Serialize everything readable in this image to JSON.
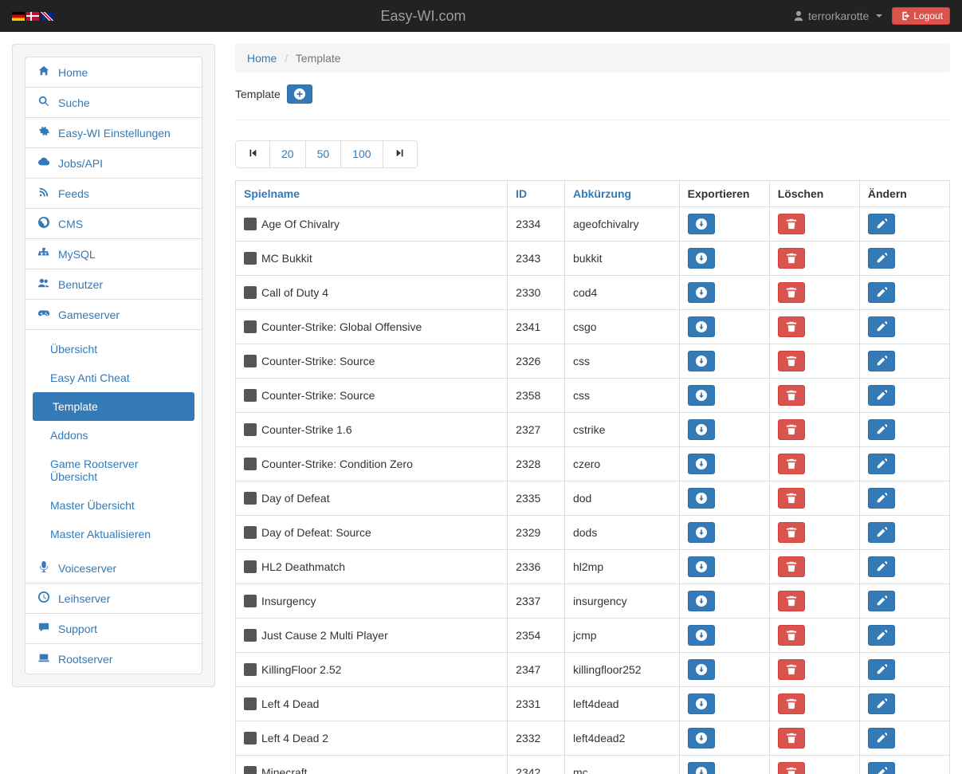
{
  "navbar": {
    "brand": "Easy-WI.com",
    "username": "terrorkarotte",
    "logout": "Logout"
  },
  "sidebar": {
    "items": [
      {
        "label": "Home",
        "icon": "home"
      },
      {
        "label": "Suche",
        "icon": "search"
      },
      {
        "label": "Easy-WI Einstellungen",
        "icon": "cogs"
      },
      {
        "label": "Jobs/API",
        "icon": "cloud"
      },
      {
        "label": "Feeds",
        "icon": "rss"
      },
      {
        "label": "CMS",
        "icon": "globe"
      },
      {
        "label": "MySQL",
        "icon": "sitemap"
      },
      {
        "label": "Benutzer",
        "icon": "users"
      },
      {
        "label": "Gameserver",
        "icon": "gamepad"
      },
      {
        "label": "Voiceserver",
        "icon": "microphone"
      },
      {
        "label": "Leihserver",
        "icon": "clock"
      },
      {
        "label": "Support",
        "icon": "comment"
      },
      {
        "label": "Rootserver",
        "icon": "laptop"
      }
    ],
    "sub": [
      {
        "label": "Übersicht",
        "active": false
      },
      {
        "label": "Easy Anti Cheat",
        "active": false
      },
      {
        "label": "Template",
        "active": true
      },
      {
        "label": "Addons",
        "active": false
      },
      {
        "label": "Game Rootserver Übersicht",
        "active": false
      },
      {
        "label": "Master Übersicht",
        "active": false
      },
      {
        "label": "Master Aktualisieren",
        "active": false
      }
    ]
  },
  "breadcrumb": {
    "home": "Home",
    "current": "Template"
  },
  "page": {
    "title": "Template"
  },
  "pagination": {
    "sizes": [
      "20",
      "50",
      "100"
    ]
  },
  "table": {
    "headers": {
      "name": "Spielname",
      "id": "ID",
      "abbr": "Abkürzung",
      "export": "Exportieren",
      "delete": "Löschen",
      "edit": "Ändern"
    },
    "rows": [
      {
        "name": "Age Of Chivalry",
        "id": "2334",
        "abbr": "ageofchivalry"
      },
      {
        "name": "MC Bukkit",
        "id": "2343",
        "abbr": "bukkit"
      },
      {
        "name": "Call of Duty 4",
        "id": "2330",
        "abbr": "cod4"
      },
      {
        "name": "Counter-Strike: Global Offensive",
        "id": "2341",
        "abbr": "csgo"
      },
      {
        "name": "Counter-Strike: Source",
        "id": "2326",
        "abbr": "css"
      },
      {
        "name": "Counter-Strike: Source",
        "id": "2358",
        "abbr": "css"
      },
      {
        "name": "Counter-Strike 1.6",
        "id": "2327",
        "abbr": "cstrike"
      },
      {
        "name": "Counter-Strike: Condition Zero",
        "id": "2328",
        "abbr": "czero"
      },
      {
        "name": "Day of Defeat",
        "id": "2335",
        "abbr": "dod"
      },
      {
        "name": "Day of Defeat: Source",
        "id": "2329",
        "abbr": "dods"
      },
      {
        "name": "HL2 Deathmatch",
        "id": "2336",
        "abbr": "hl2mp"
      },
      {
        "name": "Insurgency",
        "id": "2337",
        "abbr": "insurgency"
      },
      {
        "name": "Just Cause 2 Multi Player",
        "id": "2354",
        "abbr": "jcmp"
      },
      {
        "name": "KillingFloor 2.52",
        "id": "2347",
        "abbr": "killingfloor252"
      },
      {
        "name": "Left 4 Dead",
        "id": "2331",
        "abbr": "left4dead"
      },
      {
        "name": "Left 4 Dead 2",
        "id": "2332",
        "abbr": "left4dead2"
      },
      {
        "name": "Minecraft",
        "id": "2342",
        "abbr": "mc"
      }
    ]
  }
}
